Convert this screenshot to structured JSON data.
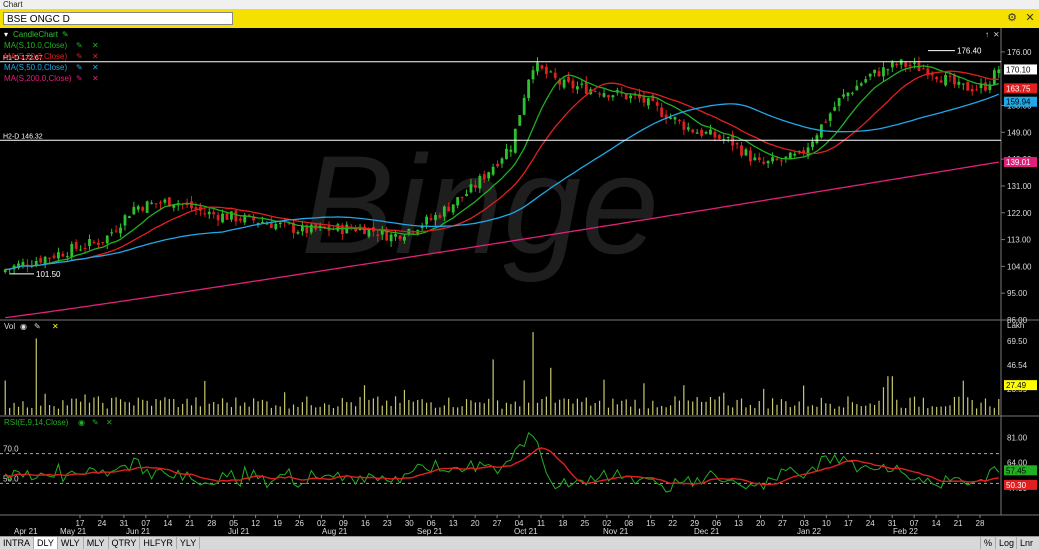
{
  "window": {
    "title": "Chart",
    "ticker": "BSE ONGC D"
  },
  "footer": {
    "timeframes": [
      "INTRA",
      "DLY",
      "WLY",
      "MLY",
      "QTRY",
      "HLFYR",
      "YLY"
    ],
    "active": "DLY",
    "right": [
      "%",
      "Log",
      "Lnr"
    ]
  },
  "colors": {
    "background": "#000000",
    "up": "#2fc02f",
    "down": "#e02020",
    "ma10": "#20b020",
    "ma20": "#e02020",
    "ma50": "#20a8e8",
    "ma200": "#e0207a",
    "volume": "#c8c870",
    "rsi": "#20b020",
    "rsi_signal": "#e02020",
    "titlebar": "#f5e000"
  },
  "main": {
    "panel_label": "CandleChart",
    "indicators": [
      {
        "label": "MA(S,10.0,Close)",
        "color": "#20b020"
      },
      {
        "label": "MA(S,20.0,Close)",
        "color": "#e02020"
      },
      {
        "label": "MA(S,50.0,Close)",
        "color": "#20a8e8"
      },
      {
        "label": "MA(S,200.0,Close)",
        "color": "#e0207a"
      }
    ],
    "hlines": [
      {
        "label": "H1-D 172.67",
        "value": 172.67
      },
      {
        "label": "H2-D 146.32",
        "value": 146.32
      }
    ],
    "high_label": "176.40",
    "low_label": "101.50",
    "watermark": "Binge",
    "yticks": [
      "176.00",
      "158.00",
      "149.00",
      "140.00",
      "131.00",
      "122.00",
      "113.00",
      "104.00",
      "95.00",
      "86.00"
    ],
    "badges": [
      {
        "text": "170.10",
        "bg": "#ffffff",
        "fg": "#000000"
      },
      {
        "text": "163.75",
        "bg": "#e02020",
        "fg": "#ffffff"
      },
      {
        "text": "159.94",
        "bg": "#20a8e8",
        "fg": "#000000"
      },
      {
        "text": "139.01",
        "bg": "#e0207a",
        "fg": "#ffffff"
      }
    ]
  },
  "volume_panel": {
    "label": "Vol",
    "unit": "Lakh",
    "yticks": [
      "69.50",
      "46.54",
      "23.59"
    ],
    "badge": "27.49"
  },
  "rsi_panel": {
    "label": "RSI(E,9,14,Close)",
    "yticks": [
      "81.00",
      "64.00",
      "47.00"
    ],
    "levels": [
      {
        "label": "70.0",
        "value": 70
      },
      {
        "label": "50.0",
        "value": 50
      }
    ],
    "badges": [
      {
        "text": "57.45",
        "bg": "#20b020",
        "fg": "#000000"
      },
      {
        "text": "50.30",
        "bg": "#e02020",
        "fg": "#ffffff"
      }
    ]
  },
  "xaxis": {
    "days": [
      "17",
      "24",
      "31",
      "07",
      "14",
      "21",
      "28",
      "05",
      "12",
      "19",
      "26",
      "02",
      "09",
      "16",
      "23",
      "30",
      "06",
      "13",
      "20",
      "27",
      "04",
      "11",
      "18",
      "25",
      "02",
      "08",
      "15",
      "22",
      "29",
      "06",
      "13",
      "20",
      "27",
      "03",
      "10",
      "17",
      "24",
      "31",
      "07",
      "14",
      "21",
      "28"
    ],
    "months": [
      "Apr 21",
      "May 21",
      "Jun 21",
      "Jul 21",
      "Aug 21",
      "Sep 21",
      "Oct 21",
      "Nov 21",
      "Dec 21",
      "Jan 22",
      "Feb 22"
    ]
  },
  "chart_data": {
    "type": "candlestick",
    "ylim": [
      86,
      182
    ],
    "anchors": [
      {
        "x": 0,
        "close": 103
      },
      {
        "x": 0.05,
        "close": 108
      },
      {
        "x": 0.1,
        "close": 113
      },
      {
        "x": 0.13,
        "close": 124
      },
      {
        "x": 0.17,
        "close": 126
      },
      {
        "x": 0.2,
        "close": 122
      },
      {
        "x": 0.26,
        "close": 119
      },
      {
        "x": 0.3,
        "close": 116
      },
      {
        "x": 0.36,
        "close": 117
      },
      {
        "x": 0.39,
        "close": 114
      },
      {
        "x": 0.43,
        "close": 120
      },
      {
        "x": 0.47,
        "close": 130
      },
      {
        "x": 0.51,
        "close": 145
      },
      {
        "x": 0.53,
        "close": 172
      },
      {
        "x": 0.56,
        "close": 165
      },
      {
        "x": 0.6,
        "close": 163
      },
      {
        "x": 0.64,
        "close": 160
      },
      {
        "x": 0.69,
        "close": 150
      },
      {
        "x": 0.73,
        "close": 146
      },
      {
        "x": 0.76,
        "close": 138
      },
      {
        "x": 0.8,
        "close": 141
      },
      {
        "x": 0.84,
        "close": 160
      },
      {
        "x": 0.87,
        "close": 168
      },
      {
        "x": 0.9,
        "close": 172
      },
      {
        "x": 0.93,
        "close": 170
      },
      {
        "x": 0.96,
        "close": 164
      },
      {
        "x": 0.985,
        "close": 164
      },
      {
        "x": 1,
        "close": 170.1
      }
    ],
    "volume_spikes": [
      {
        "x": 0.03,
        "value": 72
      },
      {
        "x": 0.49,
        "value": 52
      },
      {
        "x": 0.53,
        "value": 78
      },
      {
        "x": 0.55,
        "value": 44
      },
      {
        "x": 0.89,
        "value": 36
      }
    ]
  }
}
